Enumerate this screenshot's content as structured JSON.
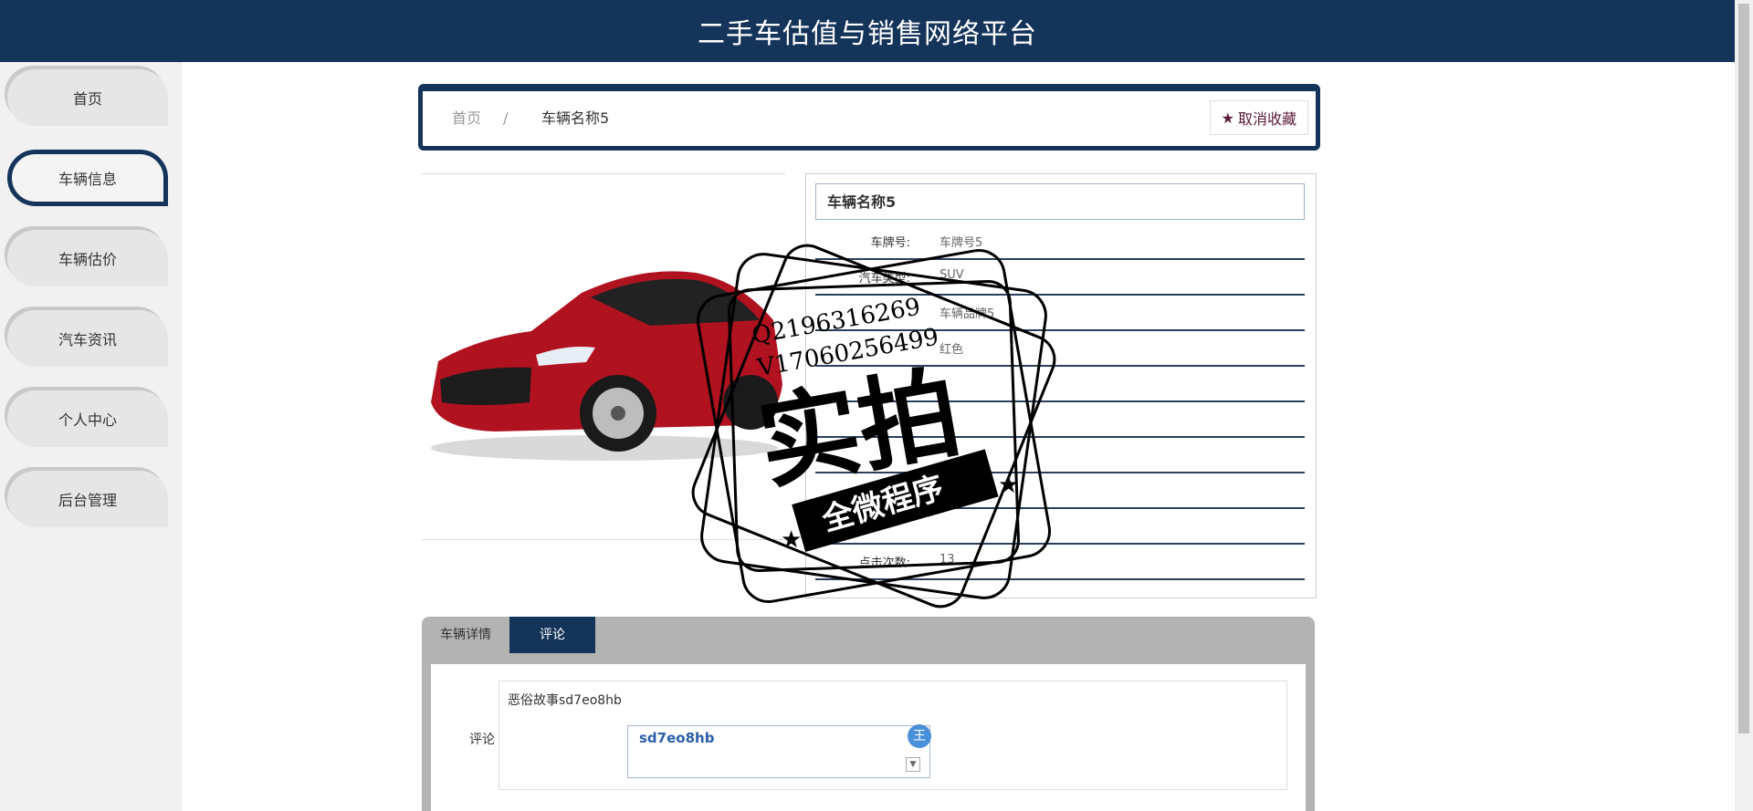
{
  "header": {
    "title": "二手车估值与销售网络平台"
  },
  "sidebar": {
    "items": [
      {
        "label": "首页",
        "active": false
      },
      {
        "label": "车辆信息",
        "active": true
      },
      {
        "label": "车辆估价",
        "active": false
      },
      {
        "label": "汽车资讯",
        "active": false
      },
      {
        "label": "个人中心",
        "active": false
      },
      {
        "label": "后台管理",
        "active": false
      }
    ]
  },
  "breadcrumb": {
    "home": "首页",
    "separator": "/",
    "current": "车辆名称5"
  },
  "favorite": {
    "label": "取消收藏",
    "icon": "star-icon"
  },
  "vehicle": {
    "name": "车辆名称5",
    "fields": [
      {
        "key": "车牌号:",
        "value": "车牌号5"
      },
      {
        "key": "汽车类型:",
        "value": "SUV"
      },
      {
        "key": "",
        "value": "车辆品牌5"
      },
      {
        "key": "",
        "value": "红色"
      },
      {
        "key": "",
        "value": ""
      },
      {
        "key": "",
        "value": ""
      },
      {
        "key": "",
        "value": ""
      },
      {
        "key": "",
        "value": ""
      },
      {
        "key": "",
        "value": ""
      },
      {
        "key": "点击次数:",
        "value": "13"
      }
    ]
  },
  "tabs": [
    {
      "label": "车辆详情",
      "active": false
    },
    {
      "label": "评论",
      "active": true
    }
  ],
  "comment": {
    "label": "评论",
    "value": "恶俗故事sd7eo8hb",
    "ime_composition": "sd7eo8hb",
    "ime_badge": "王"
  },
  "watermark": {
    "line1": "Q2196316269",
    "line2": "V17060256499",
    "main": "实拍",
    "banner": "全微程序"
  },
  "colors": {
    "brand": "#15345a",
    "accent": "#5a1a3a"
  }
}
